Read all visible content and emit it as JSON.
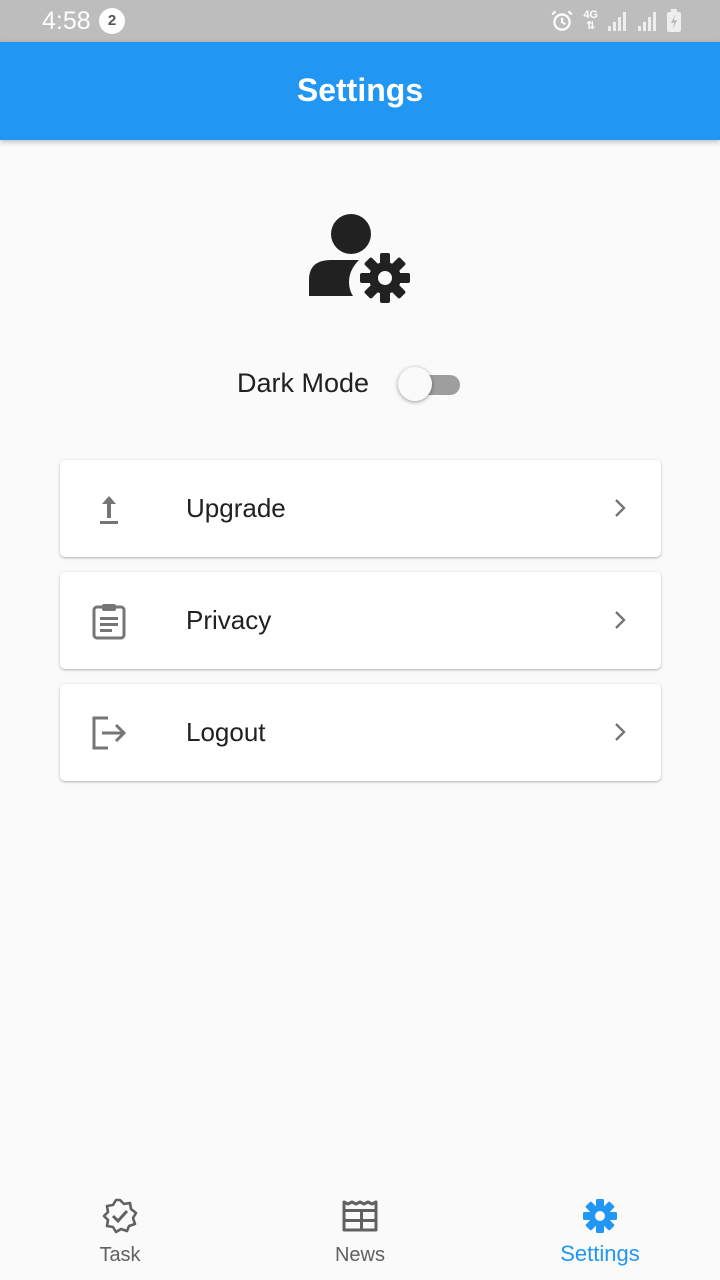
{
  "status_bar": {
    "time": "4:58",
    "notification_count": "2",
    "network_type": "4G",
    "icons": [
      "alarm-icon",
      "network-4g-icon",
      "signal-icon",
      "signal-icon",
      "battery-charging-icon"
    ]
  },
  "app_bar": {
    "title": "Settings",
    "color": "#2196f3"
  },
  "profile": {
    "icon": "user-settings-icon"
  },
  "dark_mode": {
    "label": "Dark Mode",
    "enabled": false
  },
  "menu": {
    "items": [
      {
        "label": "Upgrade",
        "icon": "upload-icon"
      },
      {
        "label": "Privacy",
        "icon": "clipboard-icon"
      },
      {
        "label": "Logout",
        "icon": "logout-icon"
      }
    ]
  },
  "bottom_nav": {
    "items": [
      {
        "label": "Task",
        "icon": "verified-badge-icon",
        "active": false
      },
      {
        "label": "News",
        "icon": "newspaper-icon",
        "active": false
      },
      {
        "label": "Settings",
        "icon": "gear-icon",
        "active": true
      }
    ],
    "active_color": "#2196f3",
    "inactive_color": "#616161"
  }
}
